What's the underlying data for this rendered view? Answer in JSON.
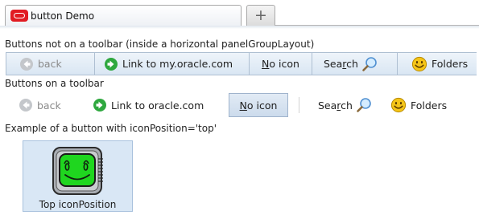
{
  "browser": {
    "tab_title": "button Demo",
    "new_tab_symbol": "+",
    "tab_icon": "oracle-logo-icon"
  },
  "section1": {
    "caption": "Buttons not on a toolbar (inside a horizontal panelGroupLayout)",
    "buttons": [
      {
        "label": "back",
        "disabled": true,
        "icon": "back-arrow-icon"
      },
      {
        "label": "Link to my.oracle.com",
        "icon": "green-arrow-icon"
      },
      {
        "label_pre": "",
        "label_key": "N",
        "label_post": "o icon"
      },
      {
        "label_pre": "Sea",
        "label_key": "r",
        "label_post": "ch",
        "icon": "magnifier-icon"
      },
      {
        "label": "Folders",
        "icon": "smiley-icon"
      }
    ]
  },
  "section2": {
    "caption": "Buttons on a toolbar",
    "buttons": [
      {
        "label": "back",
        "disabled": true,
        "icon": "back-arrow-icon"
      },
      {
        "label": "Link to oracle.com",
        "icon": "green-arrow-icon"
      },
      {
        "label_pre": "",
        "label_key": "N",
        "label_post": "o icon",
        "selected": true
      },
      {
        "label_pre": "Sea",
        "label_key": "r",
        "label_post": "ch",
        "icon": "magnifier-icon"
      },
      {
        "label": "Folders",
        "icon": "smiley-icon"
      }
    ]
  },
  "section3": {
    "caption": "Example of a button with iconPosition='top'",
    "button_label": "Top iconPosition",
    "icon": "computer-monitor-smiley-icon"
  },
  "colors": {
    "button_bg": "#d9e6f3",
    "button_border": "#aebfd2",
    "selected_bg": "#ccdbec",
    "oracle_red": "#e11b22",
    "icon_green": "#2fa83f"
  }
}
